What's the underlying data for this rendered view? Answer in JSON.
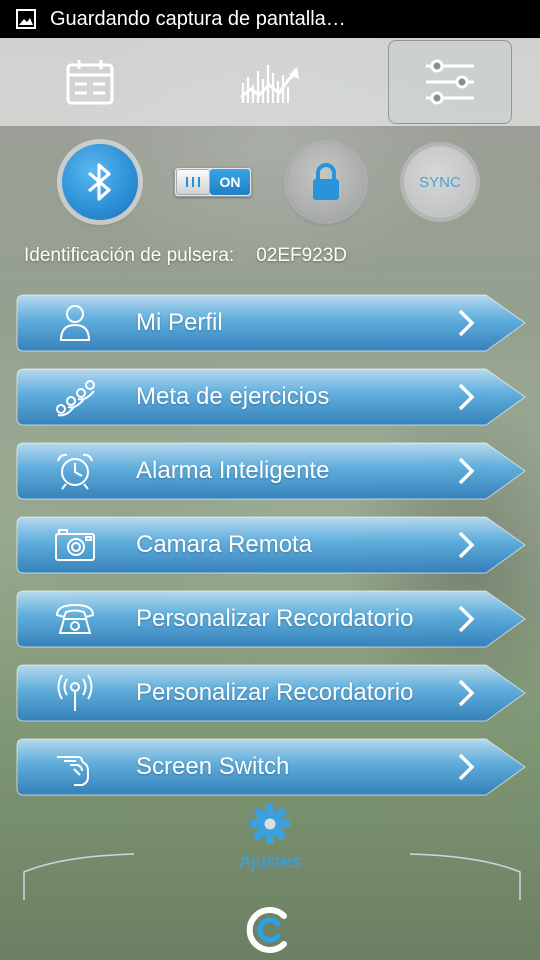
{
  "status_bar": {
    "notification_icon": "screenshot-icon",
    "text": "Guardando captura de pantalla…"
  },
  "tabs": [
    {
      "icon": "calendar-icon",
      "selected": false
    },
    {
      "icon": "chart-trend-icon",
      "selected": false
    },
    {
      "icon": "sliders-icon",
      "selected": true
    }
  ],
  "controls": {
    "bluetooth_icon": "bluetooth-icon",
    "toggle": {
      "state_label": "ON",
      "on": true
    },
    "lock_icon": "lock-icon",
    "sync_label": "SYNC"
  },
  "device": {
    "label": "Identificación de pulsera:",
    "id": "02EF923D"
  },
  "menu": {
    "items": [
      {
        "icon": "person-icon",
        "label": "Mi Perfil"
      },
      {
        "icon": "steps-icon",
        "label": "Meta de ejercicios"
      },
      {
        "icon": "alarm-clock-icon",
        "label": "Alarma Inteligente"
      },
      {
        "icon": "camera-icon",
        "label": "Camara Remota"
      },
      {
        "icon": "telephone-icon",
        "label": "Personalizar Recordatorio"
      },
      {
        "icon": "antenna-icon",
        "label": "Personalizar Recordatorio"
      },
      {
        "icon": "hand-swipe-icon",
        "label": "Screen Switch"
      }
    ]
  },
  "bottom_nav": {
    "icon": "gear-icon",
    "label": "Ajustes",
    "logo": "app-logo-icon"
  },
  "colors": {
    "accent": "#3b9fe0",
    "menu_blue": "#3e93cf",
    "status_bar": "#000000"
  }
}
